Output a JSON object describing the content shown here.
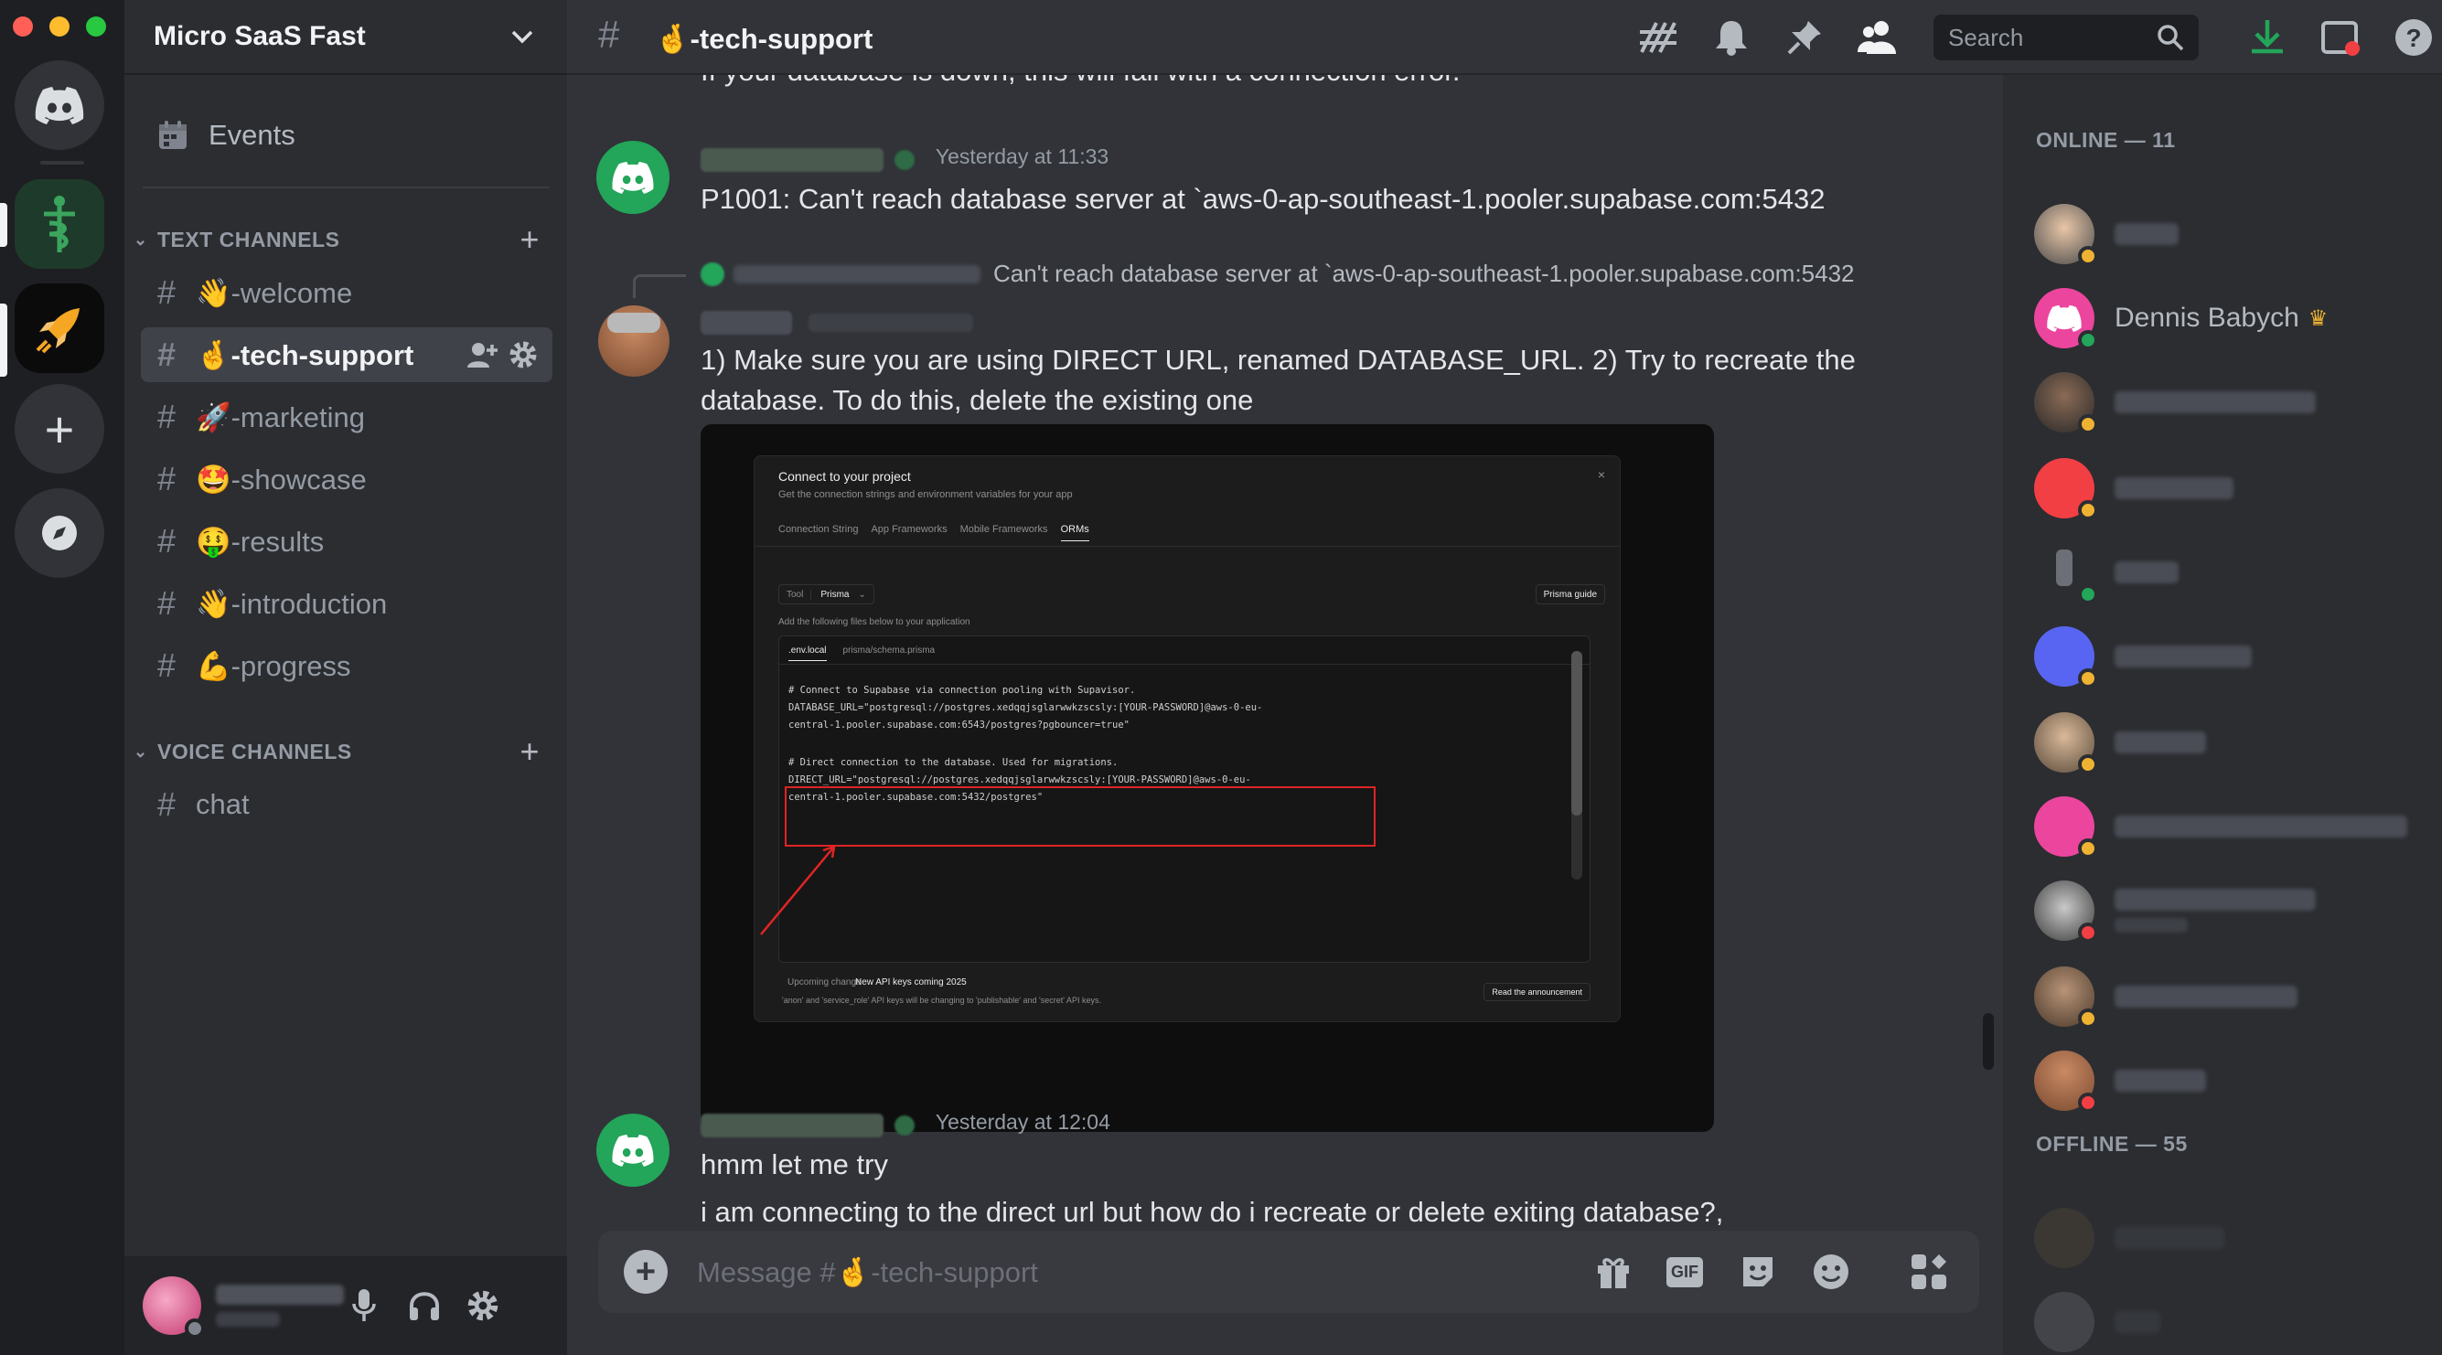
{
  "server": {
    "name": "Micro SaaS Fast"
  },
  "sidebar": {
    "events_label": "Events",
    "text_category": "TEXT CHANNELS",
    "voice_category": "VOICE CHANNELS",
    "text_channels": [
      {
        "label": "👋-welcome"
      },
      {
        "label": "🤞-tech-support",
        "active": true
      },
      {
        "label": "🚀-marketing"
      },
      {
        "label": "🤩-showcase"
      },
      {
        "label": "🤑-results"
      },
      {
        "label": "👋-introduction"
      },
      {
        "label": "💪-progress"
      }
    ],
    "voice_channels": [
      {
        "label": "chat"
      }
    ]
  },
  "header": {
    "channel": "🤞-tech-support",
    "search_placeholder": "Search"
  },
  "messages": {
    "cutoff_line": "If your database is down, this will fail with a connection error.",
    "m1_time": "Yesterday at 11:33",
    "m1_text": "P1001: Can't reach database server at `aws-0-ap-southeast-1.pooler.supabase.com:5432",
    "reply_text": "Can't reach database server at `aws-0-ap-southeast-1.pooler.supabase.com:5432",
    "m2_text": "1) Make sure you are using DIRECT URL, renamed DATABASE_URL. 2) Try to recreate the database. To do this, delete the existing one",
    "m3_time": "Yesterday at 12:04",
    "m3_line1": "hmm let me try",
    "m3_line2": "i am connecting to the direct url but how do i recreate or delete exiting database?,"
  },
  "embed": {
    "title": "Connect to your project",
    "subtitle": "Get the connection strings and environment variables for your app",
    "tabs": [
      "Connection String",
      "App Frameworks",
      "Mobile Frameworks",
      "ORMs"
    ],
    "active_tab": "ORMs",
    "tool_label": "Tool",
    "tool_value": "Prisma",
    "guide_label": "Prisma guide",
    "instruction": "Add the following files below to your application",
    "file_tabs": [
      ".env.local",
      "prisma/schema.prisma"
    ],
    "code": [
      "# Connect to Supabase via connection pooling with Supavisor.",
      "DATABASE_URL=\"postgresql://postgres.xedqqjsglarwwkzscsly:[YOUR-PASSWORD]@aws-0-eu-",
      "central-1.pooler.supabase.com:6543/postgres?pgbouncer=true\"",
      "# Direct connection to the database. Used for migrations.",
      "DIRECT_URL=\"postgresql://postgres.xedqqjsglarwwkzscsly:[YOUR-PASSWORD]@aws-0-eu-",
      "central-1.pooler.supabase.com:5432/postgres\""
    ],
    "upcoming_label": "Upcoming change",
    "upcoming_title": "New API keys coming 2025",
    "upcoming_text": "'anon' and 'service_role' API keys will be changing to 'publishable' and 'secret' API keys.",
    "announce_button": "Read the announcement"
  },
  "members": {
    "online_header": "ONLINE — 11",
    "offline_header": "OFFLINE — 55",
    "visible_name": "Dennis Babych"
  },
  "composer": {
    "placeholder": "Message #🤞-tech-support",
    "gif_label": "GIF"
  },
  "colors": {
    "accent": "#5865f2",
    "online": "#23a55a",
    "idle": "#f0b232",
    "dnd": "#f23f43"
  }
}
